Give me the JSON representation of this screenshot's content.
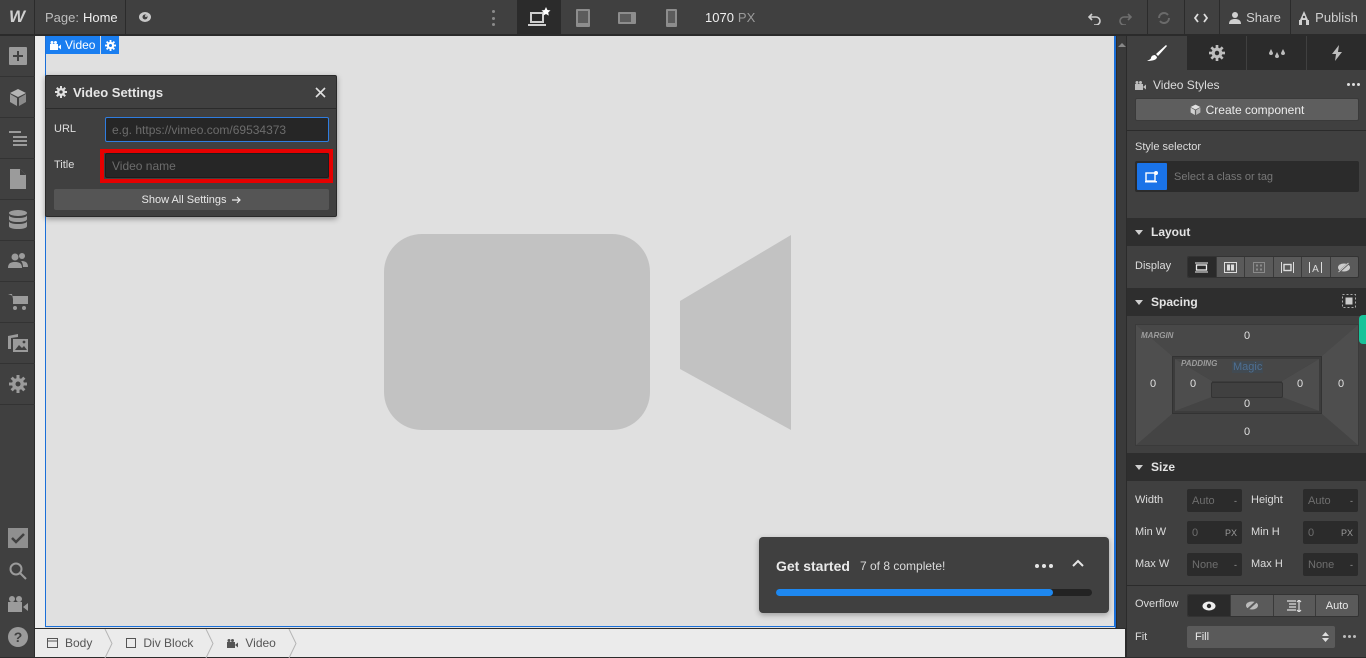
{
  "topbar": {
    "logo": "W",
    "page_prefix": "Page:",
    "page_name": "Home",
    "canvas_width": "1070",
    "canvas_unit": "PX",
    "share_label": "Share",
    "publish_label": "Publish",
    "breakpoints": [
      "desktop-base",
      "tablet",
      "mobile-landscape",
      "mobile-portrait"
    ],
    "active_breakpoint": "desktop-base"
  },
  "left_toolbar": {
    "items": [
      "add-elements",
      "symbols",
      "navigator",
      "pages",
      "cms",
      "users",
      "ecommerce",
      "assets",
      "settings"
    ],
    "bottom_items": [
      "audit",
      "search",
      "video-tutorials",
      "help"
    ]
  },
  "canvas": {
    "selected_element_label": "Video",
    "video_settings": {
      "title": "Video Settings",
      "url_label": "URL",
      "url_value": "",
      "url_placeholder": "e.g. https://vimeo.com/69534373",
      "title_label": "Title",
      "title_value": "",
      "title_placeholder": "Video name",
      "show_all_label": "Show All Settings"
    }
  },
  "get_started": {
    "title": "Get started",
    "status": "7 of 8 complete!",
    "completed": 7,
    "total": 8,
    "progress_fraction": 0.875
  },
  "breadcrumb": [
    {
      "label": "Body",
      "icon": "body-icon"
    },
    {
      "label": "Div Block",
      "icon": "div-block-icon"
    },
    {
      "label": "Video",
      "icon": "video-icon"
    }
  ],
  "right_panel": {
    "tabs": [
      "style",
      "settings",
      "style-manager",
      "interactions"
    ],
    "active_tab": "style",
    "element_styles_title": "Video Styles",
    "create_component_label": "Create component",
    "style_selector_label": "Style selector",
    "style_selector_placeholder": "Select a class or tag",
    "layout": {
      "section_title": "Layout",
      "display_label": "Display",
      "display_options": [
        "block",
        "flex",
        "grid",
        "inline-block",
        "inline",
        "none"
      ],
      "display_active": "block"
    },
    "spacing": {
      "section_title": "Spacing",
      "margin_label": "MARGIN",
      "padding_label": "PADDING",
      "magic_label": "Magic",
      "margin": {
        "top": "0",
        "right": "0",
        "bottom": "0",
        "left": "0"
      },
      "padding": {
        "top": "0",
        "right": "0",
        "bottom": "0",
        "left": "0"
      }
    },
    "size": {
      "section_title": "Size",
      "width_label": "Width",
      "width_value": "Auto",
      "width_unit": "-",
      "height_label": "Height",
      "height_value": "Auto",
      "height_unit": "-",
      "min_w_label": "Min W",
      "min_w_value": "0",
      "min_w_unit": "PX",
      "min_h_label": "Min H",
      "min_h_value": "0",
      "min_h_unit": "PX",
      "max_w_label": "Max W",
      "max_w_value": "None",
      "max_w_unit": "-",
      "max_h_label": "Max H",
      "max_h_value": "None",
      "max_h_unit": "-",
      "overflow_label": "Overflow",
      "overflow_options": [
        "visible",
        "hidden",
        "scroll",
        "Auto"
      ],
      "overflow_active": "visible",
      "fit_label": "Fit",
      "fit_value": "Fill"
    }
  },
  "colors": {
    "accent": "#1a7ef0",
    "highlight": "#e60000",
    "progress": "#1e88f0",
    "scroll_tab": "#17c39a"
  }
}
